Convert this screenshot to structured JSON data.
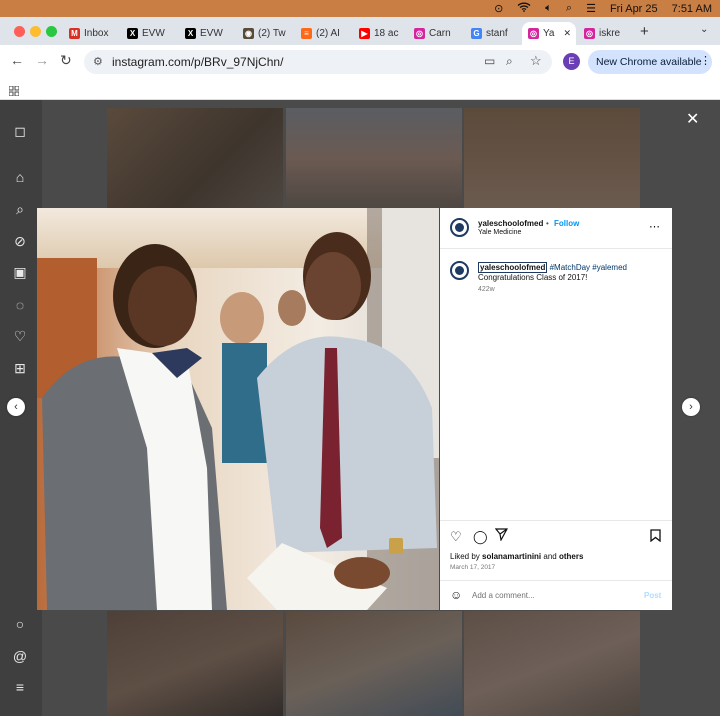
{
  "menubar": {
    "date": "Fri Apr 25",
    "time": "7:51 AM"
  },
  "tabs": [
    {
      "label": "Inbox",
      "icon": "gmail-icon",
      "color": "#d93025",
      "glyph": "M"
    },
    {
      "label": "EVW",
      "icon": "x-icon",
      "color": "#000000",
      "glyph": "X"
    },
    {
      "label": "EVW",
      "icon": "x-icon",
      "color": "#000000",
      "glyph": "X"
    },
    {
      "label": "(2) Tw",
      "icon": "twitch-icon",
      "color": "#5a4a3a",
      "glyph": "◉"
    },
    {
      "label": "(2) AI",
      "icon": "substack-icon",
      "color": "#ff6719",
      "glyph": "≡"
    },
    {
      "label": "18 ac",
      "icon": "youtube-icon",
      "color": "#ff0000",
      "glyph": "▶"
    },
    {
      "label": "Carn",
      "icon": "instagram-icon",
      "color": "#d6249f",
      "glyph": "◎"
    },
    {
      "label": "stanf",
      "icon": "google-icon",
      "color": "#4285f4",
      "glyph": "G"
    },
    {
      "label": "Ya",
      "icon": "instagram-icon",
      "color": "#d6249f",
      "glyph": "◎",
      "active": true
    },
    {
      "label": "iskre",
      "icon": "instagram-icon",
      "color": "#d6249f",
      "glyph": "◎"
    }
  ],
  "toolbar": {
    "url": "instagram.com/p/BRv_97NjChn/",
    "profile_initial": "E",
    "new_chrome": "New Chrome available"
  },
  "post": {
    "username": "yaleschoolofmed",
    "follow": "Follow",
    "subtitle": "Yale Medicine",
    "caption_user": "yaleschoolofmed",
    "caption_tags": "#MatchDay #yalemed",
    "caption_line2": "Congratulations Class of 2017!",
    "age": "422w",
    "liked_prefix": "Liked by ",
    "liked_user": "solanamartinini",
    "liked_mid": " and ",
    "liked_others": "others",
    "date": "March 17, 2017",
    "comment_placeholder": "Add a comment...",
    "post_label": "Post"
  },
  "colors": {
    "brand_blue": "#0095f6",
    "menubar": "#c97f44",
    "yale_navy": "#1e3a63"
  }
}
